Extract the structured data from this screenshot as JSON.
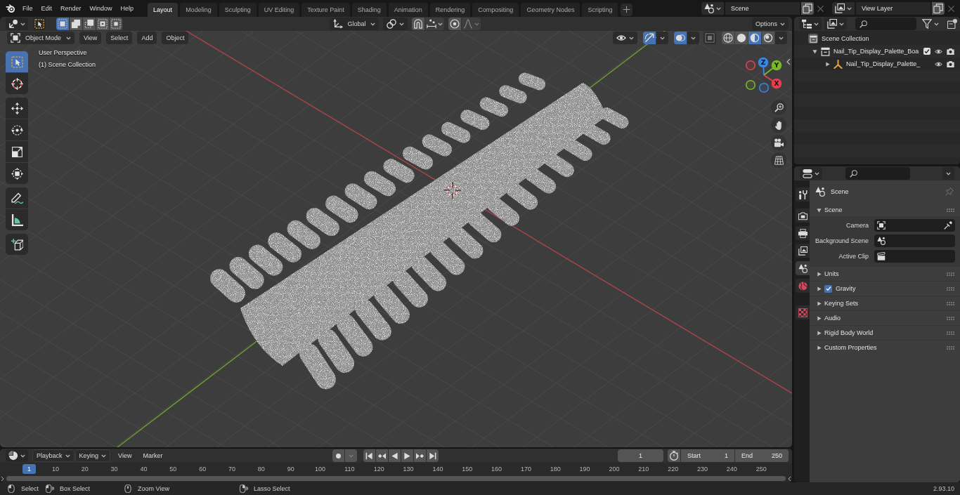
{
  "topbar": {
    "menus": [
      "File",
      "Edit",
      "Render",
      "Window",
      "Help"
    ],
    "workspaces": [
      {
        "label": "Layout",
        "selected": true
      },
      {
        "label": "Modeling",
        "selected": false
      },
      {
        "label": "Sculpting",
        "selected": false
      },
      {
        "label": "UV Editing",
        "selected": false
      },
      {
        "label": "Texture Paint",
        "selected": false
      },
      {
        "label": "Shading",
        "selected": false
      },
      {
        "label": "Animation",
        "selected": false
      },
      {
        "label": "Rendering",
        "selected": false
      },
      {
        "label": "Compositing",
        "selected": false
      },
      {
        "label": "Geometry Nodes",
        "selected": false
      },
      {
        "label": "Scripting",
        "selected": false
      }
    ],
    "scene": "Scene",
    "view_layer": "View Layer"
  },
  "viewport": {
    "tool_settings": {
      "select_modes": [
        {
          "kind": "set",
          "selected": true
        },
        {
          "kind": "extend",
          "selected": false
        },
        {
          "kind": "subtract",
          "selected": false
        },
        {
          "kind": "invert",
          "selected": false
        },
        {
          "kind": "intersect",
          "selected": false
        }
      ],
      "orientation": "Global",
      "options": "Options"
    },
    "header": {
      "mode": "Object Mode",
      "menus": [
        "View",
        "Select",
        "Add",
        "Object"
      ],
      "gizmos": true,
      "overlays": true,
      "xray": false,
      "shading": [
        {
          "kind": "wireframe",
          "selected": false
        },
        {
          "kind": "solid",
          "selected": false
        },
        {
          "kind": "material",
          "selected": true
        },
        {
          "kind": "rendered",
          "selected": false
        }
      ]
    },
    "tool_groups": [
      [
        {
          "kind": "select-box",
          "selected": true
        },
        {
          "kind": "cursor",
          "selected": false
        }
      ],
      [
        {
          "kind": "move",
          "selected": false
        },
        {
          "kind": "rotate",
          "selected": false
        },
        {
          "kind": "scale",
          "selected": false
        },
        {
          "kind": "transform",
          "selected": false
        }
      ],
      [
        {
          "kind": "annotate",
          "selected": false
        },
        {
          "kind": "measure",
          "selected": false
        }
      ],
      [
        {
          "kind": "add-cube",
          "selected": false
        }
      ]
    ],
    "info": [
      "User Perspective",
      "(1) Scene Collection"
    ],
    "axes": [
      {
        "label": "Z",
        "color": "#3b85e0"
      },
      {
        "label": "Y",
        "color": "#79b72b"
      },
      {
        "label": "X",
        "color": "#e2404f"
      }
    ]
  },
  "timeline": {
    "menus": [
      {
        "label": "Playback",
        "kind": "dropdown"
      },
      {
        "label": "Keying",
        "kind": "dropdown"
      },
      {
        "label": "View",
        "kind": "menu"
      },
      {
        "label": "Marker",
        "kind": "menu"
      }
    ],
    "current_frame": "1",
    "start": {
      "label": "Start",
      "value": "1"
    },
    "end": {
      "label": "End",
      "value": "250"
    },
    "playhead": "1",
    "ruler": [
      "10",
      "20",
      "30",
      "40",
      "50",
      "60",
      "70",
      "80",
      "90",
      "100",
      "110",
      "120",
      "130",
      "140",
      "150",
      "160",
      "170",
      "180",
      "190",
      "200",
      "210",
      "220",
      "230",
      "240",
      "250"
    ]
  },
  "outliner": {
    "tree": [
      {
        "label": "Scene Collection",
        "kind": "scene-collection",
        "children": [
          {
            "label": "Nail_Tip_Display_Palette_Boa",
            "kind": "collection",
            "expanded": true,
            "checked": true,
            "children": [
              {
                "label": "Nail_Tip_Display_Palette_",
                "kind": "empty",
                "expanded": false
              }
            ]
          }
        ]
      }
    ]
  },
  "properties": {
    "tab_groups": [
      [
        {
          "kind": "tool",
          "selected": false
        }
      ],
      [
        {
          "kind": "render",
          "selected": false
        },
        {
          "kind": "output",
          "selected": false
        },
        {
          "kind": "view-layer",
          "selected": false
        },
        {
          "kind": "scene",
          "selected": true
        },
        {
          "kind": "world",
          "selected": false
        }
      ],
      [
        {
          "kind": "texture",
          "selected": false
        }
      ]
    ],
    "context": "Scene",
    "panel": {
      "title": "Scene",
      "expanded": true,
      "fields": [
        {
          "label": "Camera",
          "kind": "camera"
        },
        {
          "label": "Background Scene",
          "kind": "scene"
        },
        {
          "label": "Active Clip",
          "kind": "clip"
        }
      ]
    },
    "subpanels": [
      {
        "label": "Units",
        "kind": "plain",
        "expanded": false
      },
      {
        "label": "Gravity",
        "kind": "toggle",
        "checked": true,
        "expanded": false
      },
      {
        "label": "Keying Sets",
        "kind": "plain",
        "expanded": false
      },
      {
        "label": "Audio",
        "kind": "plain",
        "expanded": false
      },
      {
        "label": "Rigid Body World",
        "kind": "plain",
        "expanded": false
      },
      {
        "label": "Custom Properties",
        "kind": "plain",
        "expanded": false
      }
    ]
  },
  "status_bar": {
    "hints": [
      {
        "kind": "left-click",
        "label": "Select"
      },
      {
        "kind": "left-drag",
        "label": "Box Select"
      },
      {
        "kind": "middle-click",
        "label": "Zoom View"
      },
      {
        "kind": "right-drag",
        "label": "Lasso Select"
      }
    ],
    "version": "2.93.10"
  }
}
